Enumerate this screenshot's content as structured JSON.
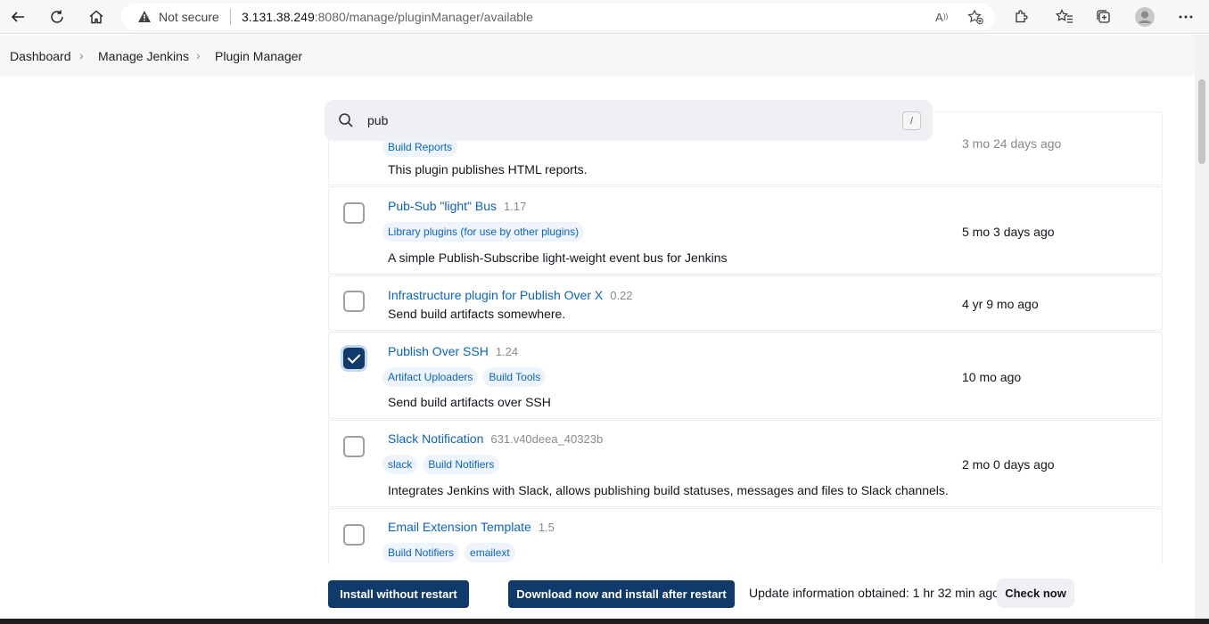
{
  "browser": {
    "security_label": "Not secure",
    "url_host": "3.131.38.249",
    "url_rest": ":8080/manage/pluginManager/available"
  },
  "breadcrumb": [
    "Dashboard",
    "Manage Jenkins",
    "Plugin Manager"
  ],
  "search": {
    "query": "pub",
    "shortcut": "/"
  },
  "plugins": [
    {
      "name": "",
      "version": "",
      "tags": [
        "Build Reports"
      ],
      "description": "This plugin publishes HTML reports.",
      "released": "3 mo 24 days ago",
      "checked": false
    },
    {
      "name": "Pub-Sub \"light\" Bus",
      "version": "1.17",
      "tags": [
        "Library plugins (for use by other plugins)"
      ],
      "description": "A simple Publish-Subscribe light-weight event bus for Jenkins",
      "released": "5 mo 3 days ago",
      "checked": false
    },
    {
      "name": "Infrastructure plugin for Publish Over X",
      "version": "0.22",
      "tags": [],
      "description": "Send build artifacts somewhere.",
      "released": "4 yr 9 mo ago",
      "checked": false
    },
    {
      "name": "Publish Over SSH",
      "version": "1.24",
      "tags": [
        "Artifact Uploaders",
        "Build Tools"
      ],
      "description": "Send build artifacts over SSH",
      "released": "10 mo ago",
      "checked": true
    },
    {
      "name": "Slack Notification",
      "version": "631.v40deea_40323b",
      "tags": [
        "slack",
        "Build Notifiers"
      ],
      "description": "Integrates Jenkins with Slack, allows publishing build statuses, messages and files to Slack channels.",
      "released": "2 mo 0 days ago",
      "checked": false
    },
    {
      "name": "Email Extension Template",
      "version": "1.5",
      "tags": [
        "Build Notifiers",
        "emailext"
      ],
      "description": "",
      "released": "",
      "checked": false
    }
  ],
  "actions": {
    "install_without_restart": "Install without restart",
    "install_after_restart": "Download now and install after restart",
    "update_info": "Update information obtained: 1 hr 32 min ago",
    "check_now": "Check now"
  }
}
